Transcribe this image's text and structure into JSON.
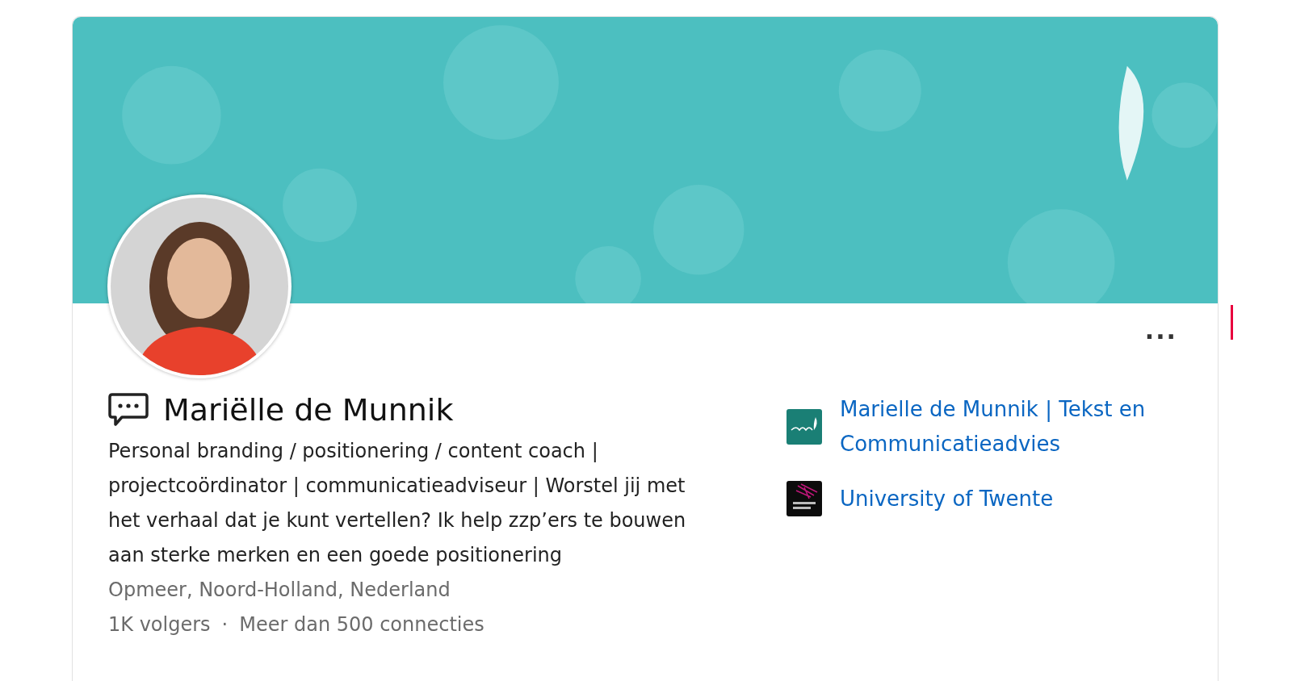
{
  "more_button": {
    "label": "..."
  },
  "profile": {
    "name": "Mariëlle de Munnik",
    "headline": "Personal branding / positionering / content coach | projectcoördinator | communicatieadviseur | Worstel jij met het verhaal dat je kunt vertellen? Ik help zzp’ers te bouwen aan sterke merken en een goede positionering",
    "location": "Opmeer, Noord-Holland, Nederland",
    "followers": "1K volgers",
    "separator": "·",
    "connections": "Meer dan 500 connecties"
  },
  "organizations": [
    {
      "kind": "company",
      "name": "Marielle de Munnik | Tekst en Communicatieadvies"
    },
    {
      "kind": "school",
      "name": "University of Twente"
    }
  ]
}
